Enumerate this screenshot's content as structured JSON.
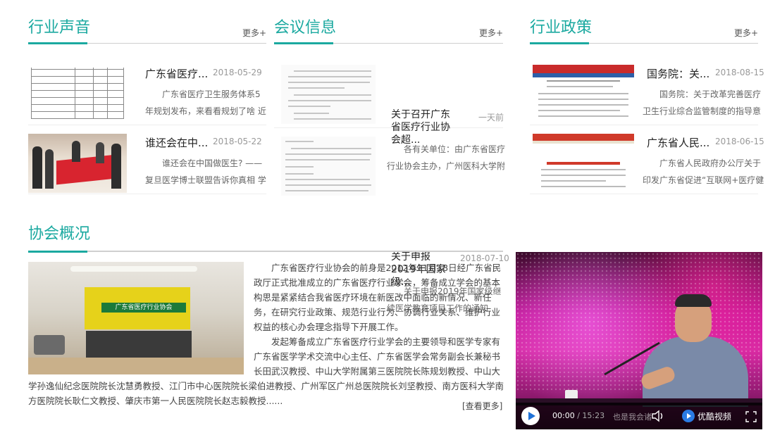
{
  "industry_voice": {
    "title": "行业声音",
    "more": "更多+",
    "items": [
      {
        "title": "广东省医疗...",
        "date": "2018-05-29",
        "desc": "广东省医疗卫生服务体系5年规划发布，来看看规划了啥 近日，广..."
      },
      {
        "title": "谁还会在中...",
        "date": "2018-05-22",
        "desc": "谁还会在中国做医生? ——复旦医学博士联盟告诉你真相 学了三..."
      }
    ]
  },
  "meeting_info": {
    "title": "会议信息",
    "more": "更多+",
    "items": [
      {
        "title": "关于召开广东省医疗行业协会超...",
        "date": "一天前",
        "desc": "各有关单位：由广东省医疗行业协会主办，广州医科大学附属第三..."
      },
      {
        "title": "关于申报2019年国家级...",
        "date": "2018-07-10",
        "desc": "关于申报2019年国家级继续医学教育项目工作的通知"
      }
    ]
  },
  "industry_policy": {
    "title": "行业政策",
    "more": "更多+",
    "items": [
      {
        "title": "国务院：关...",
        "date": "2018-08-15",
        "desc": "国务院：关于改革完善医疗卫生行业综合监管制度的指导意见 国务..."
      },
      {
        "title": "广东省人民...",
        "date": "2018-06-15",
        "desc": "广东省人民政府办公厅关于印发广东省促进“互联网+医疗健康”..."
      }
    ]
  },
  "about": {
    "title": "协会概况",
    "sign": "广东省医疗行业协会",
    "p1": "广东省医疗行业协会的前身是2012年11月18日经广东省民政厅正式批准成立的广东省医疗行业学会，筹备成立学会的基本构思是紧紧结合我省医疗环境在新医改中面临的新情况、新任务，在研究行业政策、规范行业行为、协调行业关系、维护行业权益的核心办会理念指导下开展工作。",
    "p2": "发起筹备成立广东省医疗行业学会的主要领导和医学专家有广东省医学学术交流中心主任、广东省医学会常务副会长兼秘书长田武汉教授、中山大学附属第三医院院长陈规划教授、中山大学孙逸仙纪念医院院长沈慧勇教授、江门市中心医院院长梁伯进教授、广州军区广州总医院院长刘坚教授、南方医科大学南方医院院长耿仁文教授、肇庆市第一人民医院院长赵志毅教授......",
    "more": "[查看更多]"
  },
  "video": {
    "current_time": "00:00",
    "total_time": "/ 15:23",
    "subtitle": "也是我会诸",
    "brand": "优酷视频",
    "icons": [
      "play-icon",
      "volume-icon",
      "youku-logo-icon",
      "fullscreen-icon"
    ]
  },
  "colors": {
    "accent": "#1ba9a0"
  }
}
